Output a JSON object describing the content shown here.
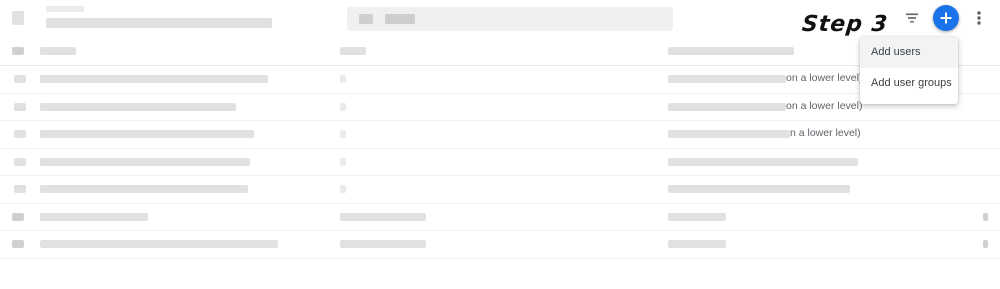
{
  "annotation": {
    "step_label": "Step 3"
  },
  "toolbar": {
    "filter_icon": "filter-list-icon",
    "add_icon": "plus-icon",
    "more_icon": "more-vert-icon",
    "add_color": "#1a73e8"
  },
  "add_menu": {
    "items": [
      {
        "label": "Add users"
      },
      {
        "label": "Add user groups"
      }
    ]
  },
  "table": {
    "rows": [
      {
        "tail": "on a lower level)"
      },
      {
        "tail": "on a lower level)"
      },
      {
        "tail": "n a lower level)"
      },
      {
        "tail": ""
      },
      {
        "tail": ""
      },
      {
        "tail": ""
      },
      {
        "tail": ""
      }
    ]
  }
}
